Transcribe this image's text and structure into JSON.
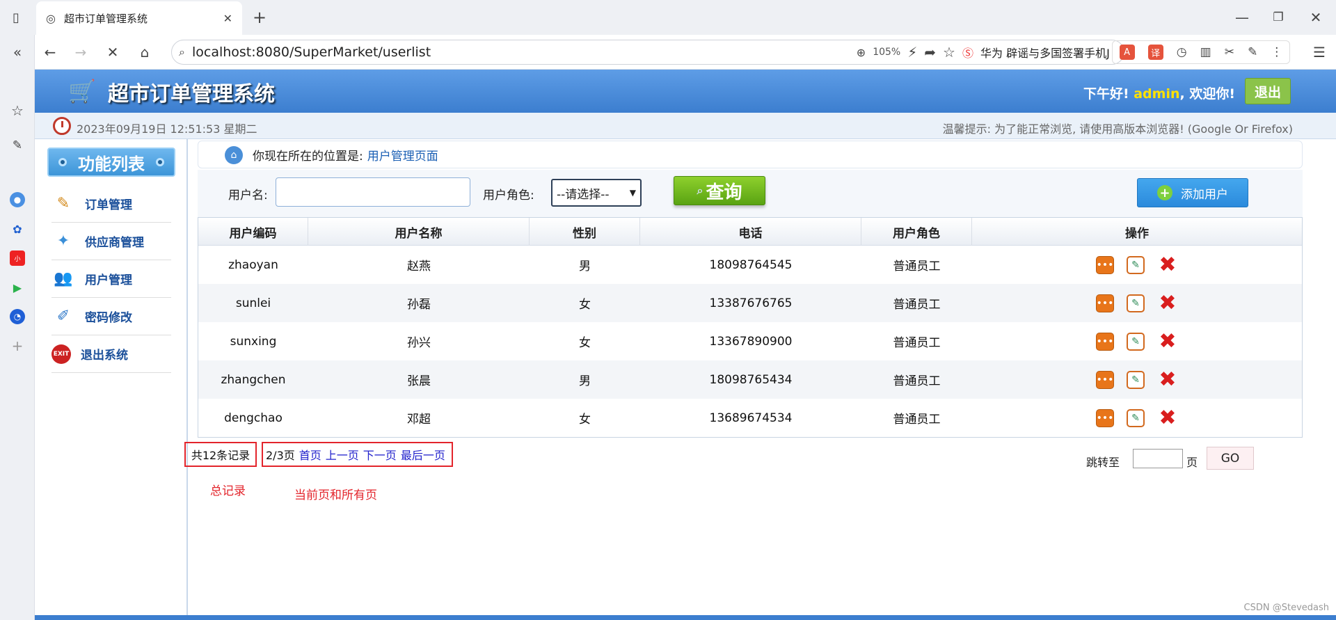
{
  "browser": {
    "tab_title": "超市订单管理系统",
    "url": "localhost:8080/SuperMarket/userlist",
    "zoom": "105%",
    "news_text": "华为 辟谣与多国签署手机J"
  },
  "header": {
    "system_title": "超市订单管理系统",
    "greeting_prefix": "下午好!",
    "username": "admin",
    "greeting_suffix": ", 欢迎你!",
    "logout_label": "退出"
  },
  "infobar": {
    "datetime": "2023年09月19日 12:51:53 星期二",
    "tip": "温馨提示: 为了能正常浏览, 请使用高版本浏览器! (Google Or Firefox)"
  },
  "menu": {
    "title": "功能列表",
    "items": [
      {
        "label": "订单管理",
        "icon": "order-icon"
      },
      {
        "label": "供应商管理",
        "icon": "supplier-icon"
      },
      {
        "label": "用户管理",
        "icon": "users-icon"
      },
      {
        "label": "密码修改",
        "icon": "password-icon"
      },
      {
        "label": "退出系统",
        "icon": "exit-icon"
      }
    ]
  },
  "breadcrumb": {
    "prefix": "你现在所在的位置是:",
    "location": "用户管理页面"
  },
  "search": {
    "username_label": "用户名:",
    "username_value": "",
    "role_label": "用户角色:",
    "role_selected": "--请选择--",
    "query_label": "查询",
    "add_label": "添加用户"
  },
  "table": {
    "headers": [
      "用户编码",
      "用户名称",
      "性别",
      "电话",
      "用户角色",
      "操作"
    ],
    "rows": [
      [
        "zhaoyan",
        "赵燕",
        "男",
        "18098764545",
        "普通员工"
      ],
      [
        "sunlei",
        "孙磊",
        "女",
        "13387676765",
        "普通员工"
      ],
      [
        "sunxing",
        "孙兴",
        "女",
        "13367890900",
        "普通员工"
      ],
      [
        "zhangchen",
        "张晨",
        "男",
        "18098765434",
        "普通员工"
      ],
      [
        "dengchao",
        "邓超",
        "女",
        "13689674534",
        "普通员工"
      ]
    ]
  },
  "pagination": {
    "total": "共12条记录",
    "page_info": "2/3页",
    "first": "首页",
    "prev": "上一页",
    "next": "下一页",
    "last": "最后一页",
    "jump_label": "跳转至",
    "page_unit": "页",
    "go_label": "GO"
  },
  "annotations": {
    "total_note": "总记录",
    "page_note": "当前页和所有页"
  },
  "watermark": "CSDN @Stevedash",
  "colors": {
    "header_blue": "#3c7ecf",
    "query_green": "#59a312",
    "add_blue": "#2b8adc",
    "annotation_red": "#e3242b"
  }
}
